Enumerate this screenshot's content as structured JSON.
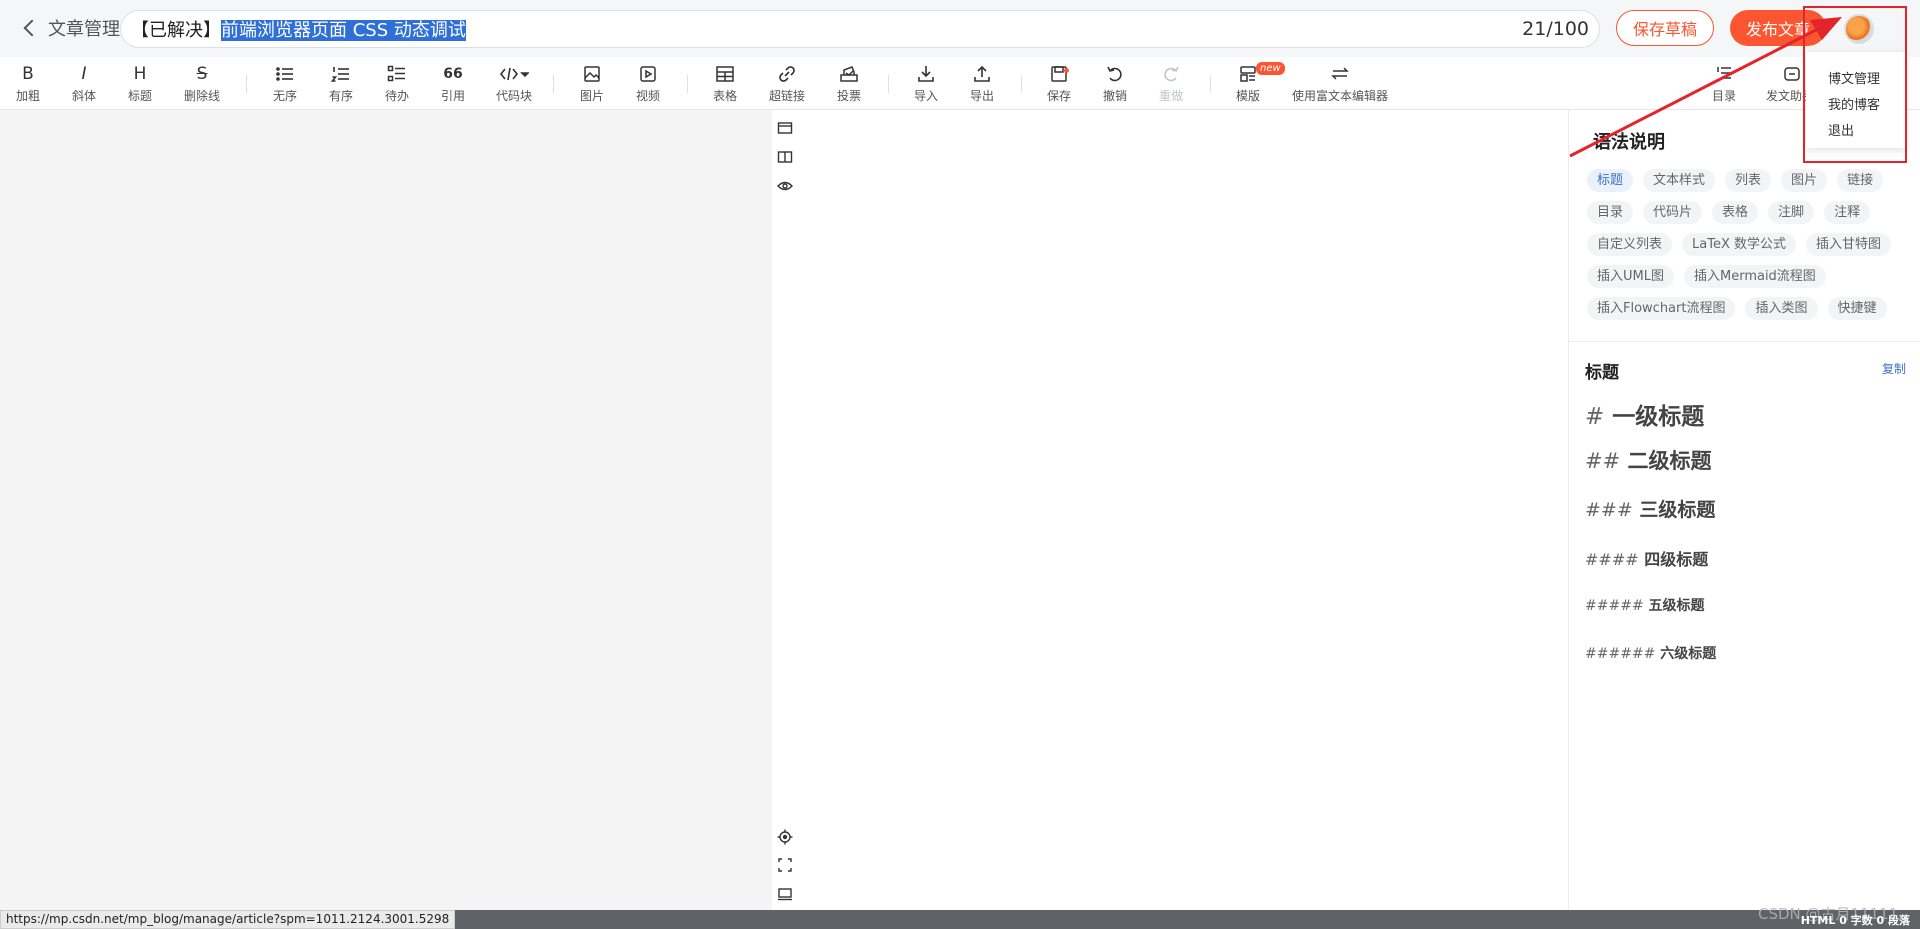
{
  "header": {
    "back_label": "文章管理",
    "title_prefix": "【已解决】",
    "title_selected": "前端浏览器页面 CSS 动态调试",
    "title_count": "21/100",
    "save_draft": "保存草稿",
    "publish": "发布文章"
  },
  "toolbar": {
    "bold": "加粗",
    "italic": "斜体",
    "heading": "标题",
    "strike": "删除线",
    "ul": "无序",
    "ol": "有序",
    "todo": "待办",
    "quote": "引用",
    "code": "代码块",
    "image": "图片",
    "video": "视频",
    "table": "表格",
    "link": "超链接",
    "vote": "投票",
    "import": "导入",
    "export": "导出",
    "save": "保存",
    "undo": "撤销",
    "redo": "重做",
    "template": "模版",
    "template_badge": "new",
    "rich": "使用富文本编辑器",
    "toc": "目录",
    "publish_help": "发文助手",
    "bold_glyph": "B",
    "italic_glyph": "I",
    "heading_glyph": "H",
    "strike_glyph": "S",
    "quote_glyph": "66"
  },
  "menu": {
    "items": [
      "博文管理",
      "我的博客",
      "退出"
    ]
  },
  "help": {
    "title": "语法说明",
    "tags": [
      "标题",
      "文本样式",
      "列表",
      "图片",
      "链接",
      "目录",
      "代码片",
      "表格",
      "注脚",
      "注释",
      "自定义列表",
      "LaTeX 数学公式",
      "插入甘特图",
      "插入UML图",
      "插入Mermaid流程图",
      "插入Flowchart流程图",
      "插入类图",
      "快捷键"
    ],
    "section_title": "标题",
    "copy": "复制",
    "h1_hash": "#",
    "h1": "一级标题",
    "h2_hash": "##",
    "h2": "二级标题",
    "h3_hash": "###",
    "h3": "三级标题",
    "h4_hash": "####",
    "h4": "四级标题",
    "h5_hash": "#####",
    "h5": "五级标题",
    "h6_hash": "######",
    "h6": "六级标题"
  },
  "status": {
    "url": "https://mp.csdn.net/mp_blog/manage/article?spm=1011.2124.3001.5298",
    "info": "HTML  0 字数  0 段落",
    "watermark": "CSDN @古月11111"
  },
  "colors": {
    "accent": "#fc5531",
    "link": "#3a72c9",
    "annotation": "#e3242b"
  }
}
